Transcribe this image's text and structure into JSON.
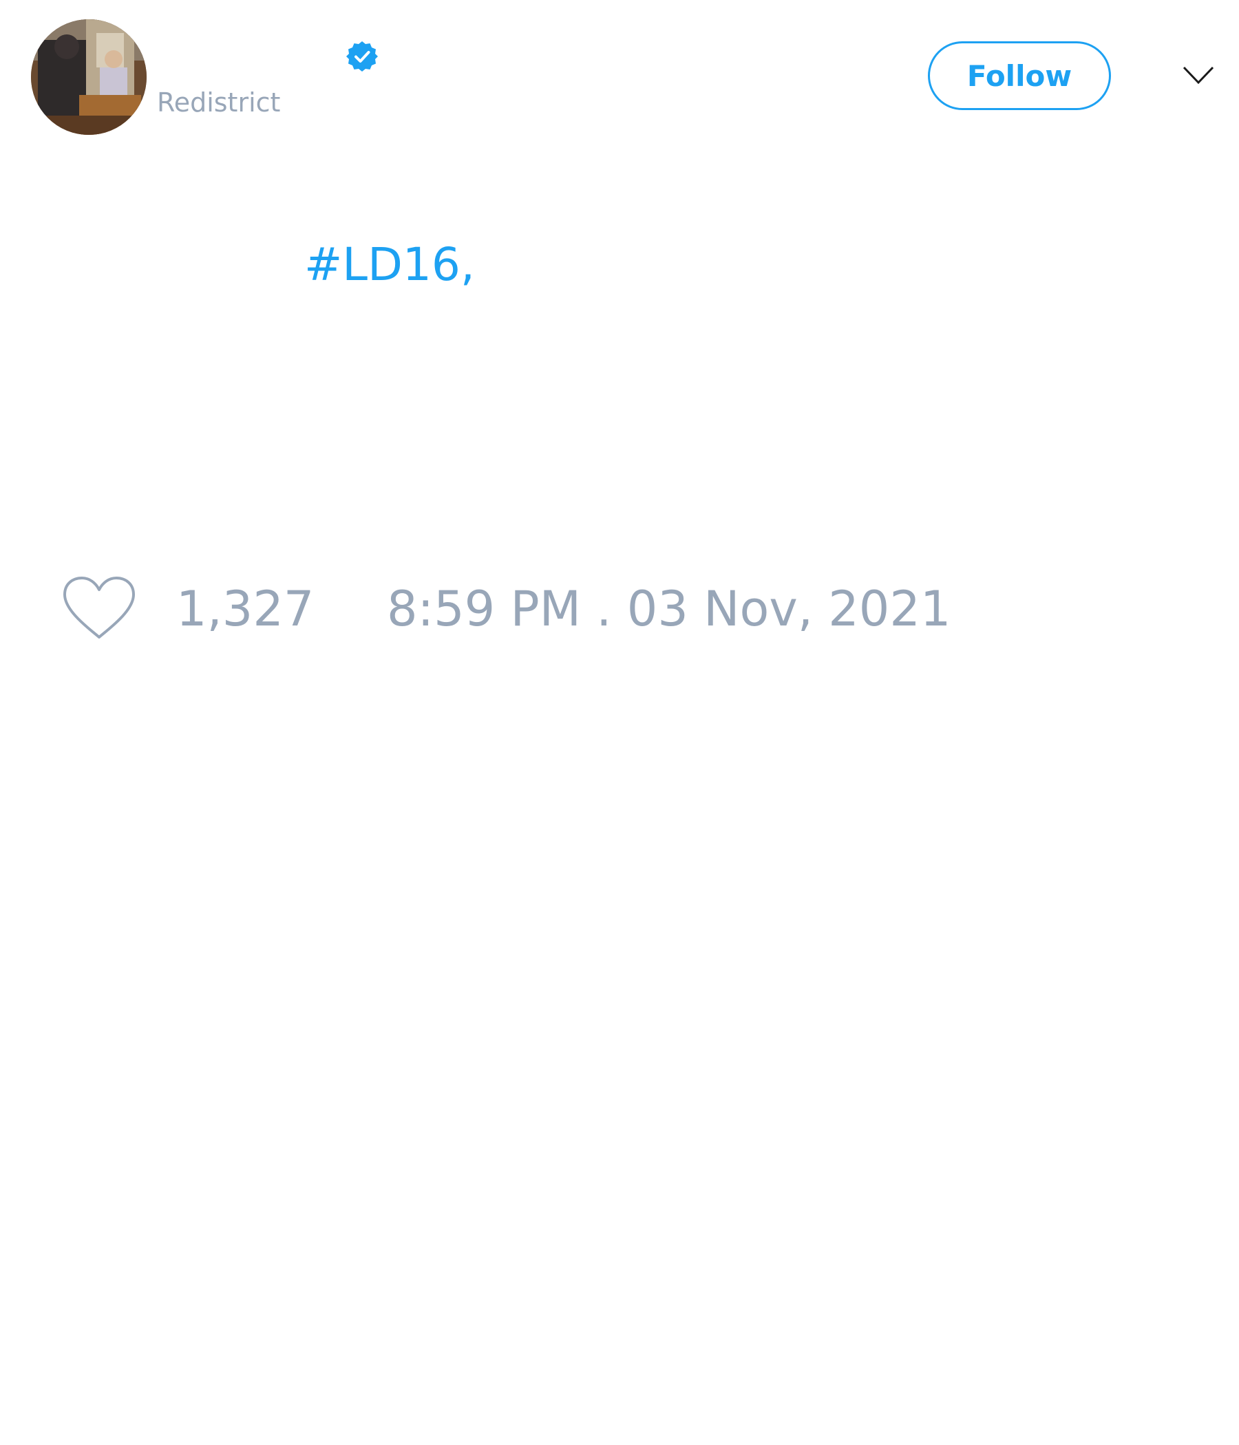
{
  "author": {
    "handle": "Redistrict",
    "verified": true,
    "avatar_icon": "profile-photo"
  },
  "actions": {
    "follow_label": "Follow",
    "menu_icon": "chevron-down-icon"
  },
  "tweet": {
    "text": "#LD16,",
    "like_count": "1,327",
    "timestamp": "8:59 PM . 03 Nov, 2021"
  },
  "colors": {
    "accent": "#1da1f2",
    "muted_text": "#98a6b8",
    "background": "#ffffff"
  }
}
